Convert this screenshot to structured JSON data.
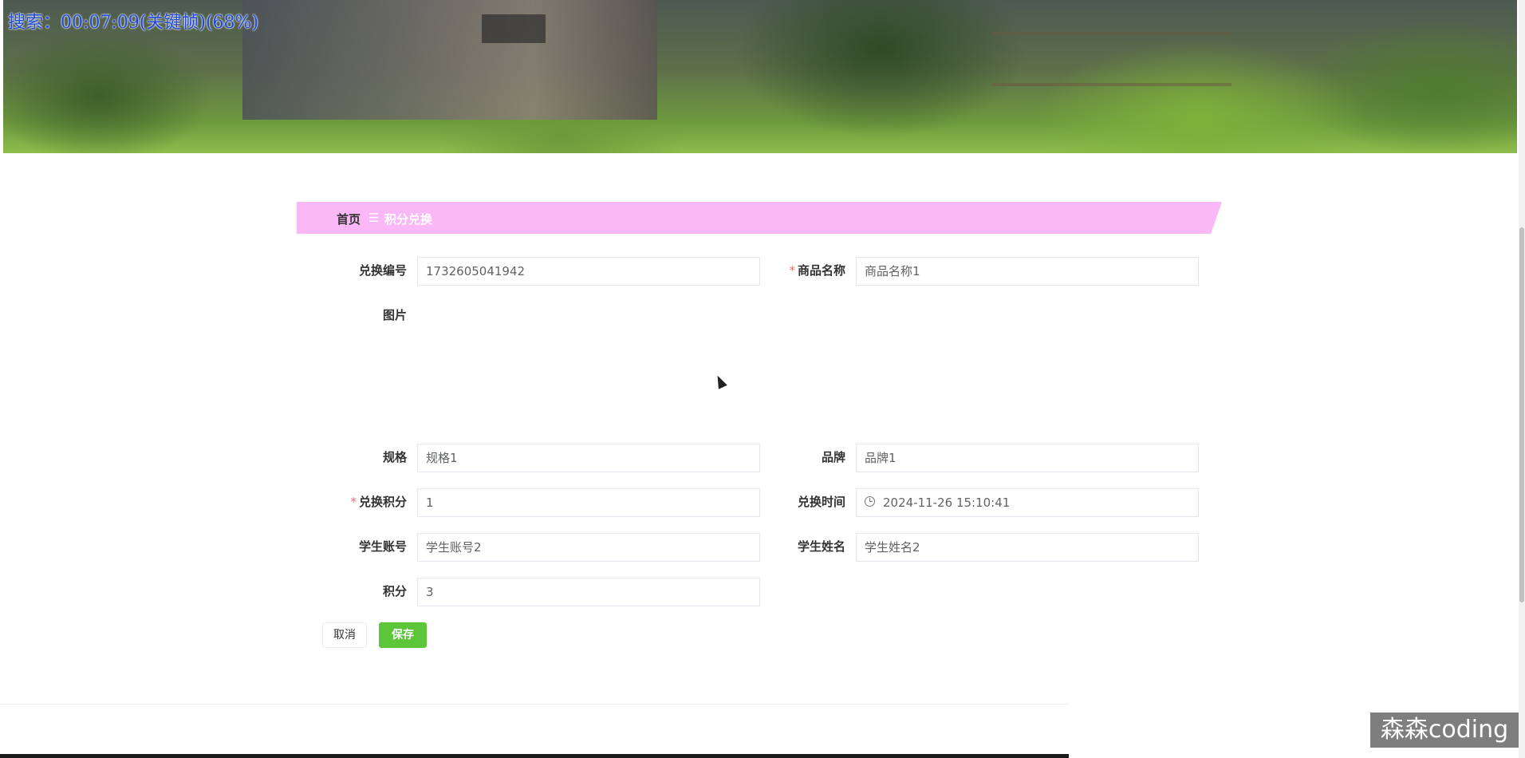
{
  "overlay": {
    "search_text": "搜索：00:07:09(关键帧)(68%)"
  },
  "breadcrumb": {
    "home": "首页",
    "separator": "☰",
    "current": "积分兑换"
  },
  "form": {
    "exchange_no": {
      "label": "兑换编号",
      "value": "1732605041942"
    },
    "product_name": {
      "label": "商品名称",
      "required_mark": "*",
      "value": "商品名称1"
    },
    "image": {
      "label": "图片"
    },
    "spec": {
      "label": "规格",
      "value": "规格1"
    },
    "brand": {
      "label": "品牌",
      "value": "品牌1"
    },
    "points_used": {
      "label": "兑换积分",
      "required_mark": "*",
      "value": "1"
    },
    "exchange_time": {
      "label": "兑换时间",
      "value": "2024-11-26 15:10:41"
    },
    "student_account": {
      "label": "学生账号",
      "value": "学生账号2"
    },
    "student_name": {
      "label": "学生姓名",
      "value": "学生姓名2"
    },
    "points": {
      "label": "积分",
      "value": "3"
    }
  },
  "actions": {
    "cancel": "取消",
    "save": "保存"
  },
  "watermark": "森森coding",
  "colors": {
    "breadcrumb_bg": "#fbb8f6",
    "save_button": "#5cc53a",
    "required": "#f56c6c",
    "overlay_text": "#1f49d6"
  }
}
